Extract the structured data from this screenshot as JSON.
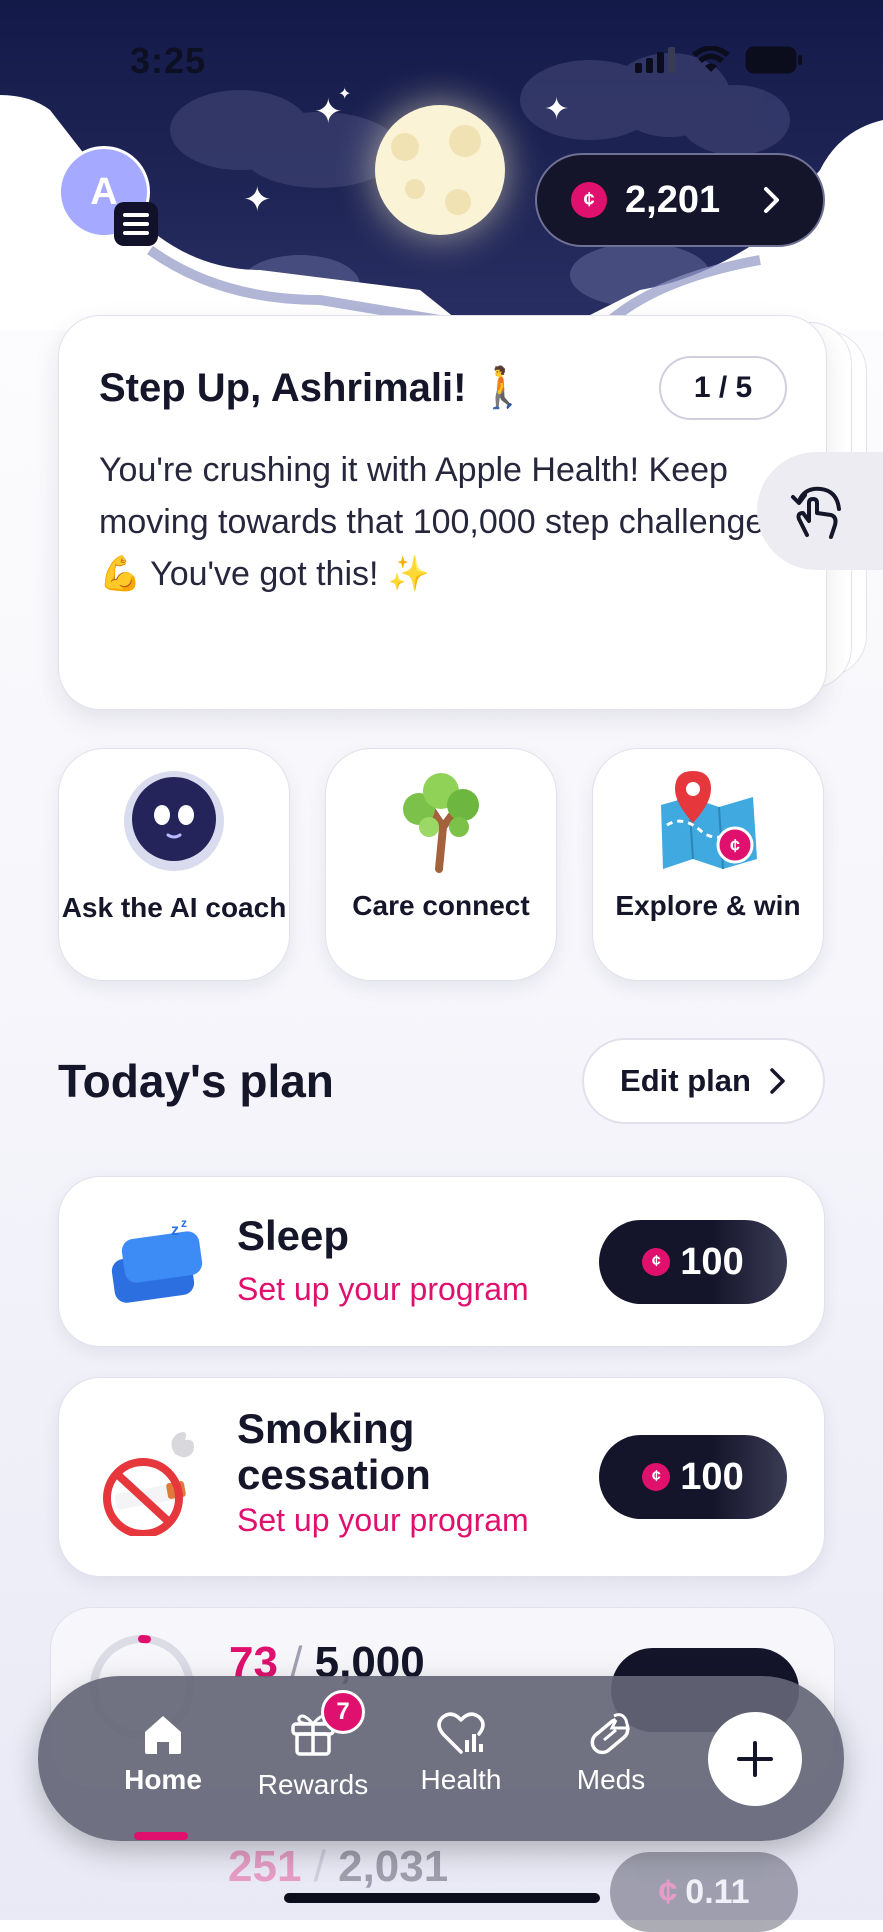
{
  "status_bar": {
    "time": "3:25"
  },
  "header": {
    "avatar_initial": "A",
    "points": "2,201"
  },
  "coach_card": {
    "title": "Step Up, Ashrimali! 🚶",
    "counter": "1 / 5",
    "body": "You're crushing it with Apple Health! Keep moving towards that 100,000 step challenge. 💪 You've got this! ✨"
  },
  "quick_actions": [
    {
      "label": "Ask the AI coach",
      "icon": "ai-coach-robot-icon"
    },
    {
      "label": "Care connect",
      "icon": "tree-icon"
    },
    {
      "label": "Explore & win",
      "icon": "map-pin-icon"
    }
  ],
  "plan": {
    "title": "Today's plan",
    "edit_label": "Edit plan",
    "items": [
      {
        "name": "Sleep",
        "subtitle": "Set up your program",
        "reward": "100",
        "icon": "pillow-icon"
      },
      {
        "name": "Smoking cessation",
        "subtitle": "Set up your program",
        "reward": "100",
        "icon": "no-smoking-icon"
      }
    ],
    "steps": {
      "current": "73",
      "total": "5,000"
    },
    "faded": {
      "current": "251",
      "total": "2,031",
      "reward": "0.11"
    }
  },
  "tabbar": {
    "tabs": [
      {
        "label": "Home",
        "icon": "home-icon",
        "active": true
      },
      {
        "label": "Rewards",
        "icon": "gift-icon",
        "badge": "7"
      },
      {
        "label": "Health",
        "icon": "heart-chart-icon"
      },
      {
        "label": "Meds",
        "icon": "pill-bell-icon"
      }
    ]
  },
  "colors": {
    "accent": "#e0106e",
    "dark": "#14152a",
    "sky": "#1f2556"
  }
}
